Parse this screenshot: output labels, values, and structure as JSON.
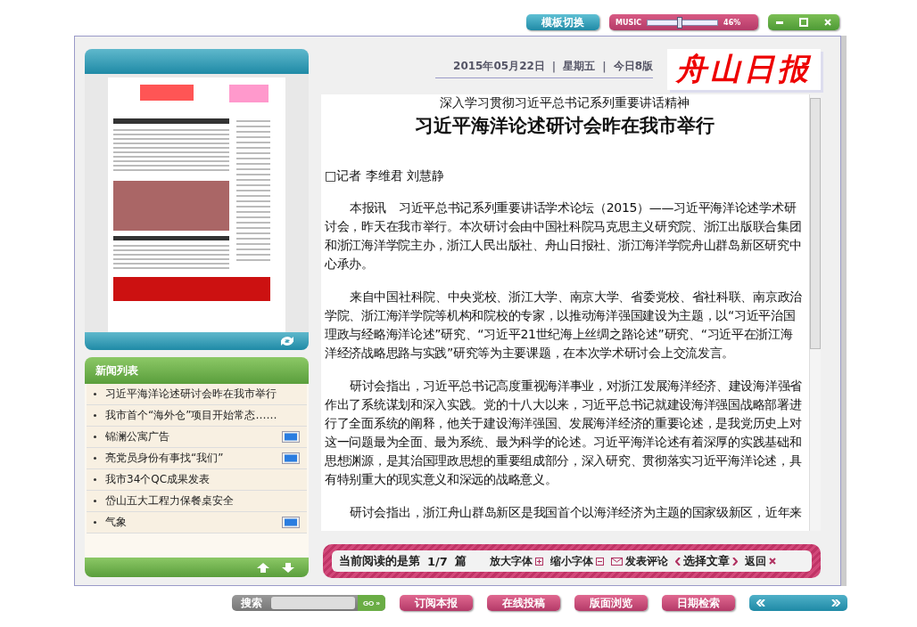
{
  "top_bar": {
    "template_button": "模板切换",
    "music": {
      "label": "MUSIC",
      "level": 0.46,
      "reading": "46%"
    }
  },
  "header": {
    "date": "2015年05月22日",
    "separators": [
      "|",
      "|"
    ],
    "weekday": "星期五",
    "edition": "今日8版",
    "logo": "舟山日报"
  },
  "news_list": {
    "title": "新闻列表",
    "items": [
      {
        "title": "习近平海洋论述研讨会昨在我市举行",
        "image": false
      },
      {
        "title": "我市首个“海外仓”项目开始常态……",
        "image": false
      },
      {
        "title": "锦澜公寓广告",
        "image": true
      },
      {
        "title": "亮党员身份有事找“我们”",
        "image": true
      },
      {
        "title": "我市34个QC成果发表",
        "image": false
      },
      {
        "title": "岱山五大工程力保餐桌安全",
        "image": false
      },
      {
        "title": "气象",
        "image": true
      }
    ]
  },
  "article": {
    "kicker": "深入学习贯彻习近平总书记系列重要讲话精神",
    "headline": "习近平海洋论述研讨会昨在我市举行",
    "byline": "□记者 李维君 刘慧静",
    "paragraphs": [
      "本报讯　习近平总书记系列重要讲话学术论坛（2015）——习近平海洋论述学术研讨会，昨天在我市举行。本次研讨会由中国社科院马克思主义研究院、浙江出版联合集团和浙江海洋学院主办，浙江人民出版社、舟山日报社、浙江海洋学院舟山群岛新区研究中心承办。",
      "来自中国社科院、中央党校、浙江大学、南京大学、省委党校、省社科联、南京政治学院、浙江海洋学院等机构和院校的专家，以推动海洋强国建设为主题，以“习近平治国理政与经略海洋论述”研究、“习近平21世纪海上丝绸之路论述”研究、“习近平在浙江海洋经济战略思路与实践”研究等为主要课题，在本次学术研讨会上交流发言。",
      "研讨会指出，习近平总书记高度重视海洋事业，对浙江发展海洋经济、建设海洋强省作出了系统谋划和深入实践。党的十八大以来，习近平总书记就建设海洋强国战略部署进行了全面系统的阐释，他关于建设海洋强国、发展海洋经济的重要论述，是我党历史上对这一问题最为全面、最为系统、最为科学的论述。习近平海洋论述有着深厚的实践基础和思想渊源，是其治国理政思想的重要组成部分，深入研究、贯彻落实习近平海洋论述，具有特别重大的现实意义和深远的战略意义。",
      "研讨会指出，浙江舟山群岛新区是我国首个以海洋经济为主题的国家级新区，近年来"
    ]
  },
  "reader_bar": {
    "status": "当前阅读的是第",
    "count": "1/7",
    "unit": "篇",
    "enlarge": "放大字体",
    "shrink": "缩小字体",
    "comment": "发表评论",
    "select": "选择文章",
    "back": "返回"
  },
  "bottom_bar": {
    "search_label": "搜索",
    "go": "GO »",
    "buttons": [
      "订阅本报",
      "在线投稿",
      "版面浏览",
      "日期检索"
    ]
  }
}
